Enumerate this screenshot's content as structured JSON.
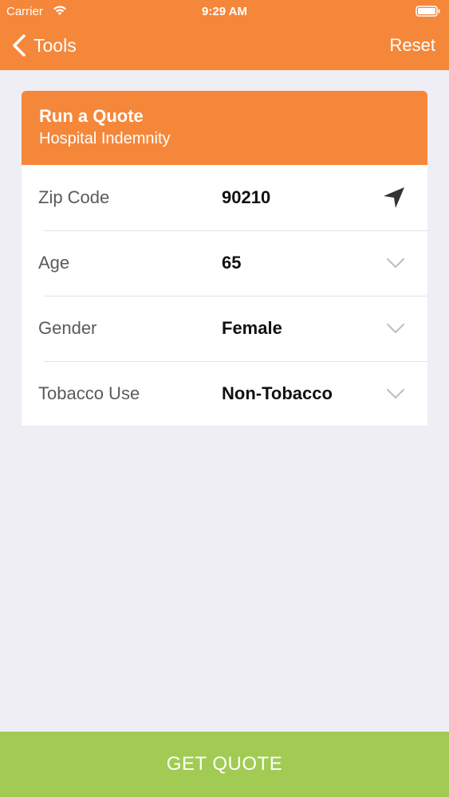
{
  "status_bar": {
    "carrier": "Carrier",
    "time": "9:29 AM"
  },
  "nav": {
    "back_label": "Tools",
    "reset_label": "Reset"
  },
  "card": {
    "title": "Run a Quote",
    "subtitle": "Hospital Indemnity",
    "rows": [
      {
        "label": "Zip Code",
        "value": "90210",
        "icon": "location-arrow-icon"
      },
      {
        "label": "Age",
        "value": "65",
        "icon": "chevron-down-icon"
      },
      {
        "label": "Gender",
        "value": "Female",
        "icon": "chevron-down-icon"
      },
      {
        "label": "Tobacco Use",
        "value": "Non-Tobacco",
        "icon": "chevron-down-icon"
      }
    ]
  },
  "footer": {
    "get_quote_label": "GET QUOTE"
  },
  "colors": {
    "accent": "#F5873A",
    "action": "#A1CB53",
    "background": "#EFEEF4"
  }
}
